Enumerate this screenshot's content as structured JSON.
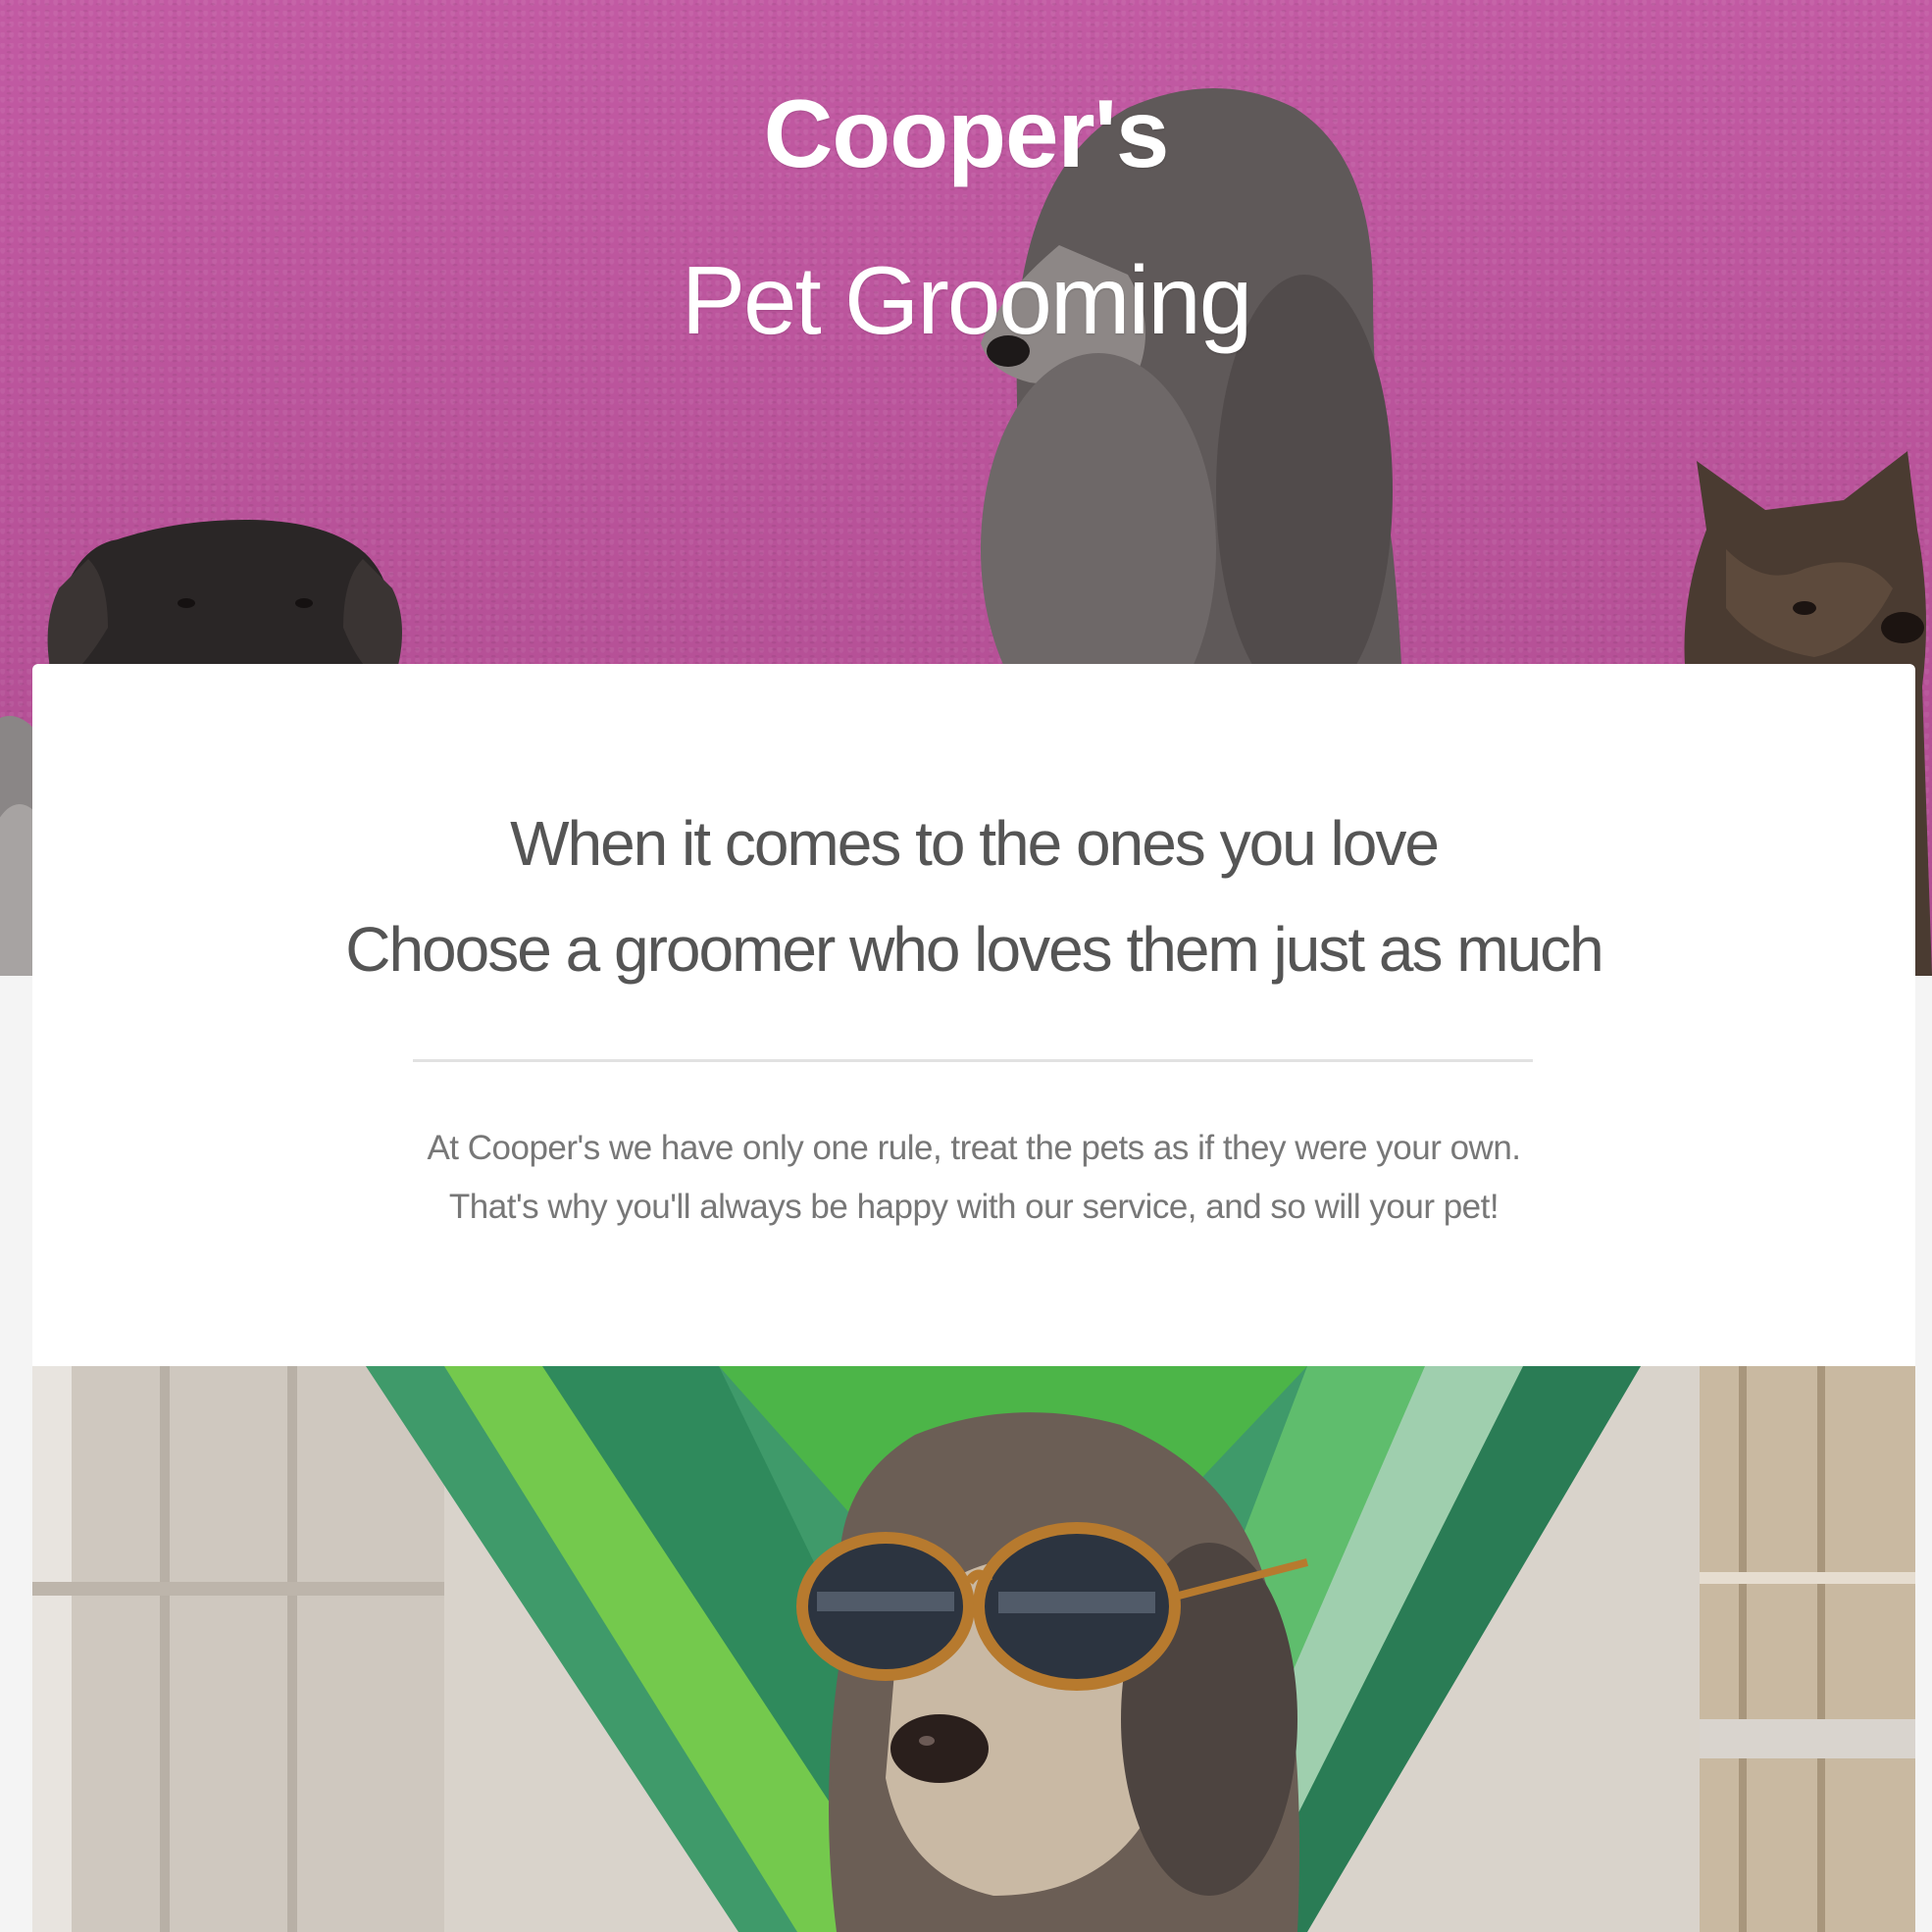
{
  "hero": {
    "brand_name": "Cooper's",
    "brand_subtitle": "Pet Grooming",
    "background_color": "#b85299"
  },
  "intro_card": {
    "headline_line1": "When it comes to the ones you love",
    "headline_line2": "Choose a groomer who loves them just as much",
    "body_line1": "At Cooper's we have only one rule, treat the pets as if they were your own.",
    "body_line2": "That's why you'll always be happy with our service, and so will your pet!"
  },
  "feature_photo": {
    "subject": "dog-in-hammock-with-sunglasses",
    "hammock_color": "#6fcf4a"
  }
}
